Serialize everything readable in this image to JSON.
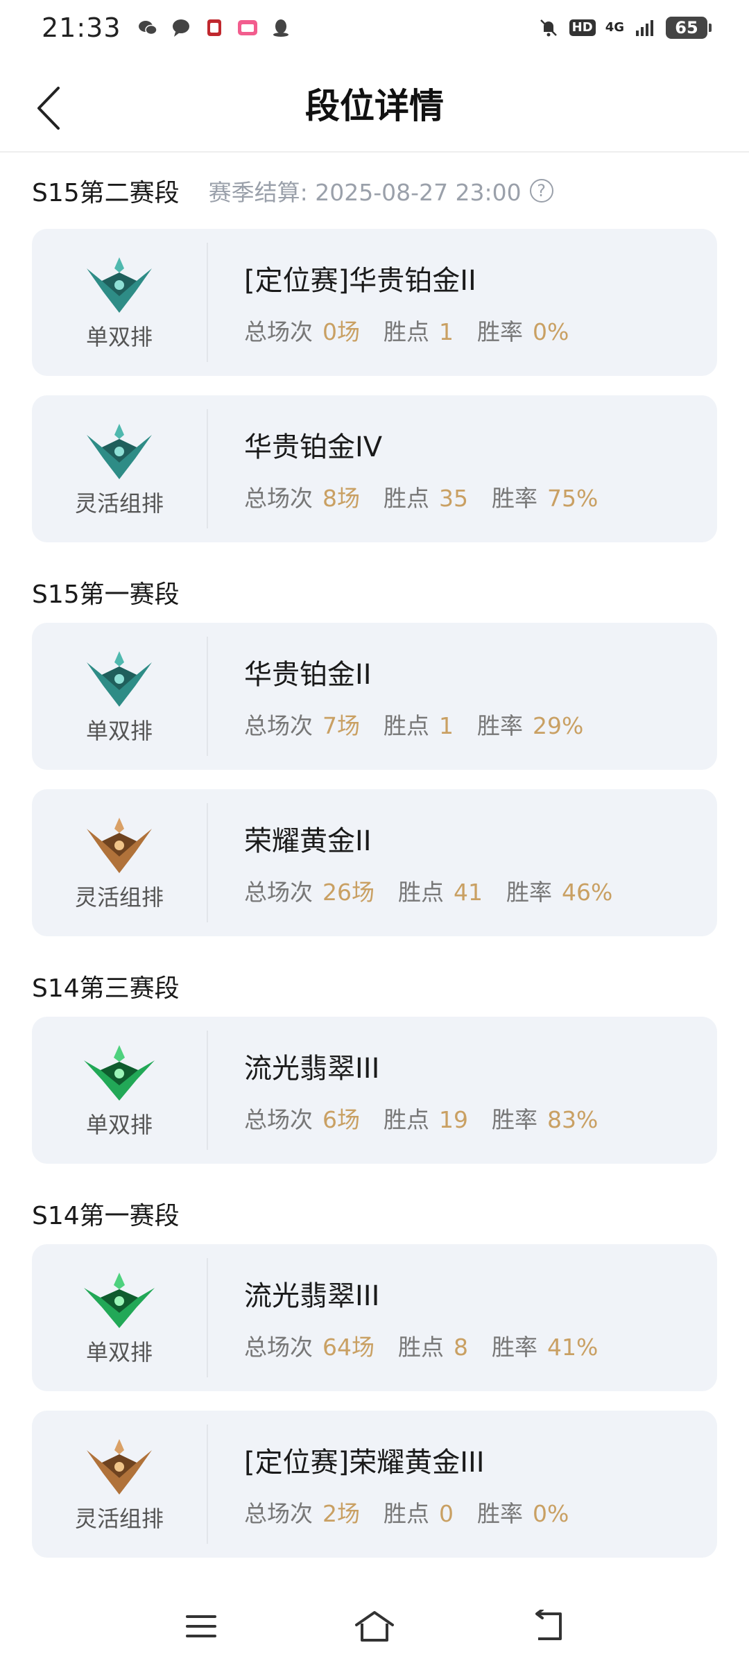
{
  "status": {
    "time": "21:33",
    "network": "4G",
    "hd": "HD",
    "battery": "65"
  },
  "header": {
    "title": "段位详情"
  },
  "colors": {
    "accent": "#c9a063",
    "card_bg": "#f0f3f8",
    "platinum": "#2e8c86",
    "gold": "#b0723a",
    "emerald": "#22a857"
  },
  "sections": [
    {
      "title": "S15第二赛段",
      "season_end": "赛季结算: 2025-08-27 23:00",
      "help": "?",
      "cards": [
        {
          "emblem": "platinum-emblem-icon",
          "queue": "单双排",
          "rank": "[定位赛]华贵铂金II",
          "games_label": "总场次",
          "games": "0场",
          "lp_label": "胜点",
          "lp": "1",
          "wr_label": "胜率",
          "wr": "0%"
        },
        {
          "emblem": "platinum-emblem-icon",
          "queue": "灵活组排",
          "rank": "华贵铂金IV",
          "games_label": "总场次",
          "games": "8场",
          "lp_label": "胜点",
          "lp": "35",
          "wr_label": "胜率",
          "wr": "75%"
        }
      ]
    },
    {
      "title": "S15第一赛段",
      "cards": [
        {
          "emblem": "platinum-emblem-icon",
          "queue": "单双排",
          "rank": "华贵铂金II",
          "games_label": "总场次",
          "games": "7场",
          "lp_label": "胜点",
          "lp": "1",
          "wr_label": "胜率",
          "wr": "29%"
        },
        {
          "emblem": "gold-emblem-icon",
          "queue": "灵活组排",
          "rank": "荣耀黄金II",
          "games_label": "总场次",
          "games": "26场",
          "lp_label": "胜点",
          "lp": "41",
          "wr_label": "胜率",
          "wr": "46%"
        }
      ]
    },
    {
      "title": "S14第三赛段",
      "cards": [
        {
          "emblem": "emerald-emblem-icon",
          "queue": "单双排",
          "rank": "流光翡翠III",
          "games_label": "总场次",
          "games": "6场",
          "lp_label": "胜点",
          "lp": "19",
          "wr_label": "胜率",
          "wr": "83%"
        }
      ]
    },
    {
      "title": "S14第一赛段",
      "cards": [
        {
          "emblem": "emerald-emblem-icon",
          "queue": "单双排",
          "rank": "流光翡翠III",
          "games_label": "总场次",
          "games": "64场",
          "lp_label": "胜点",
          "lp": "8",
          "wr_label": "胜率",
          "wr": "41%"
        },
        {
          "emblem": "gold-emblem-icon",
          "queue": "灵活组排",
          "rank": "[定位赛]荣耀黄金III",
          "games_label": "总场次",
          "games": "2场",
          "lp_label": "胜点",
          "lp": "0",
          "wr_label": "胜率",
          "wr": "0%"
        }
      ]
    }
  ]
}
